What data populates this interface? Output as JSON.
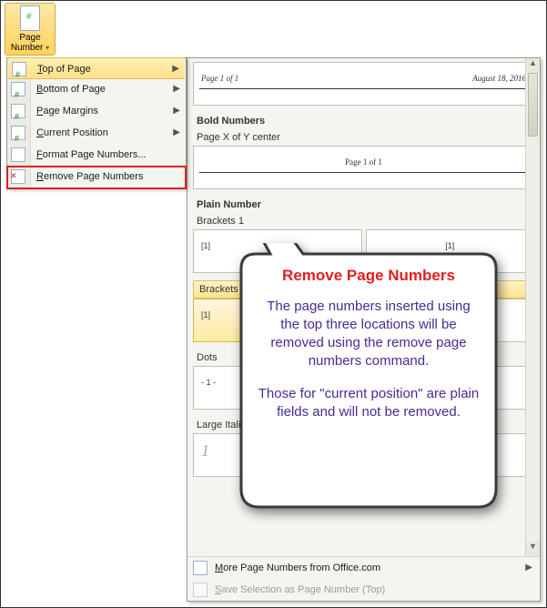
{
  "ribbon": {
    "page_number_label_l1": "Page",
    "page_number_label_l2": "Number"
  },
  "menu": {
    "top_of_page": "Top of Page",
    "bottom_of_page": "Bottom of Page",
    "page_margins": "Page Margins",
    "current_position": "Current Position",
    "format": "Format Page Numbers...",
    "remove": "Remove Page Numbers"
  },
  "gallery": {
    "row1": {
      "page_of": "Page 1 of 1",
      "date": "August 18, 2016"
    },
    "sec_bold": "Bold Numbers",
    "sec_bold_sample": "Page X of Y center",
    "sec_plain": "Plain Number",
    "brackets1": "Brackets 1",
    "brackets2": "Brackets 2",
    "dots": "Dots",
    "large_italics": "Large Italics 1",
    "bracket_val": "[1]",
    "dot_val": "- 1 -",
    "italic_val": "1",
    "page_of_center": "Page 1 of 1"
  },
  "footer": {
    "more": "More Page Numbers from Office.com",
    "save_sel": "Save Selection as Page Number (Top)"
  },
  "callout": {
    "title": "Remove Page Numbers",
    "p1": "The page numbers inserted using the top three locations will be removed using the remove page numbers command.",
    "p2": "Those for \"current position\" are plain fields and will not be removed."
  }
}
